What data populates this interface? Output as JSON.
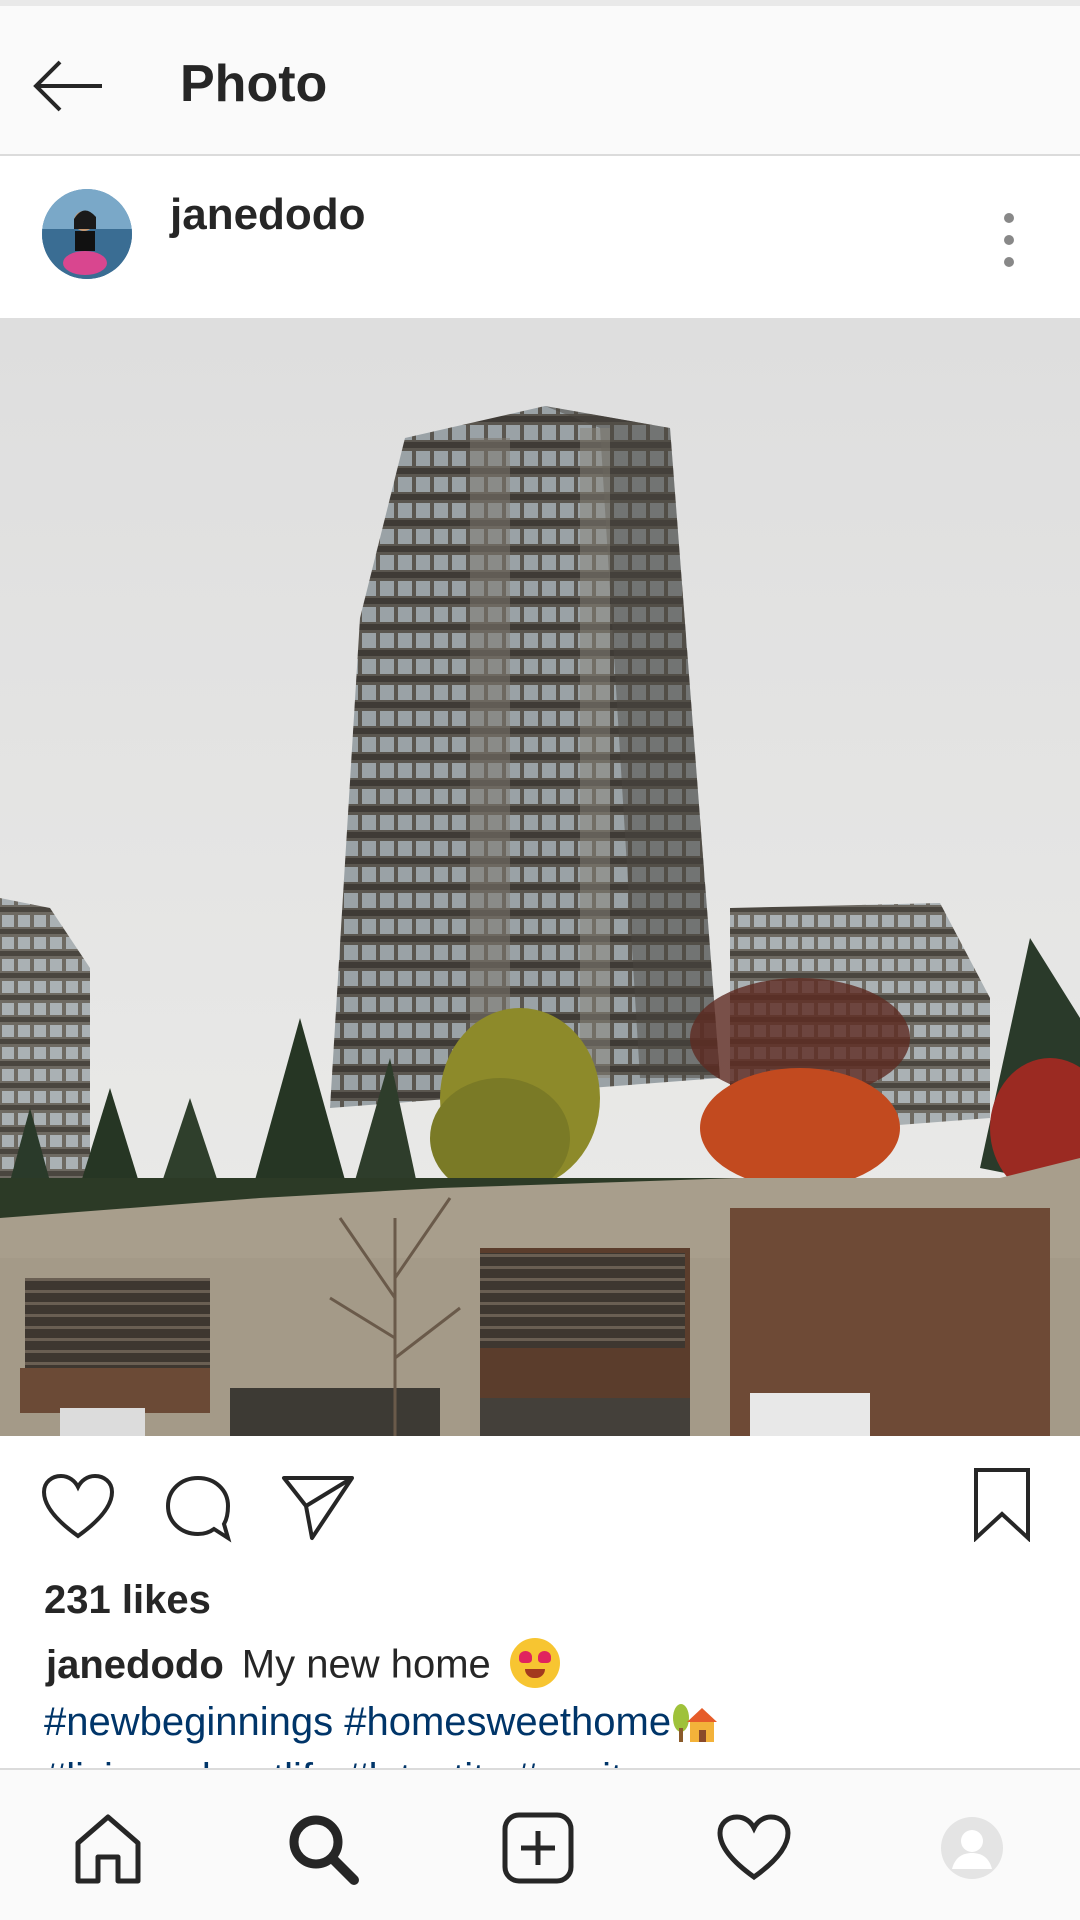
{
  "header": {
    "title": "Photo"
  },
  "post": {
    "username": "janedodo",
    "likes": "231 likes",
    "caption": "My new home",
    "hashtags": "#newbeginnings #homesweethome",
    "hashtags_partial": "#livingonlycotlife #latestity #eayits"
  },
  "icons": {
    "back": "arrow-left-icon",
    "more": "more-vertical-icon",
    "like": "heart-outline-icon",
    "comment": "comment-bubble-icon",
    "share": "paper-plane-icon",
    "save": "bookmark-icon",
    "nav": [
      "home-icon",
      "search-icon",
      "add-post-icon",
      "activity-heart-icon",
      "profile-icon"
    ]
  }
}
